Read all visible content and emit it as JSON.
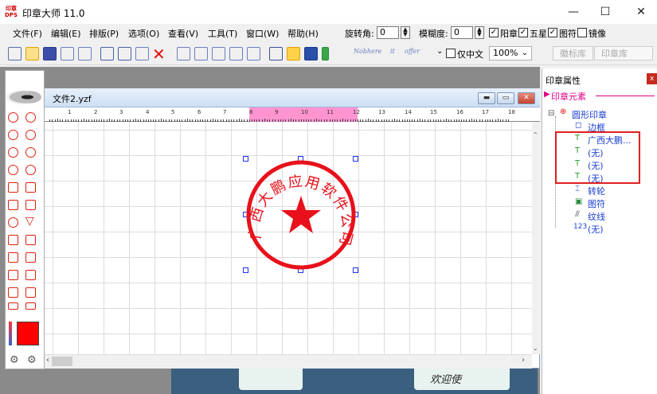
{
  "app": {
    "title": "印章大师 11.0",
    "logo_line1": "印章",
    "logo_line2": "DPS"
  },
  "window_controls": {
    "minimize": "—",
    "maximize": "☐",
    "close": "✕"
  },
  "menu": [
    "文件(F)",
    "编辑(E)",
    "排版(P)",
    "选项(O)",
    "查看(V)",
    "工具(T)",
    "窗口(W)",
    "帮助(H)"
  ],
  "controls": {
    "rotation_label": "旋转角:",
    "rotation_value": "0",
    "blur_label": "模糊度:",
    "blur_value": "0",
    "checkboxes": [
      {
        "label": "阳章",
        "checked": true
      },
      {
        "label": "五星",
        "checked": true
      },
      {
        "label": "图符",
        "checked": true
      },
      {
        "label": "镜像",
        "checked": false
      }
    ]
  },
  "toolbar": {
    "font_sample_1": "Nobhere",
    "font_sample_2": "it",
    "font_sample_3": "offer",
    "chinese_only_label": "仅中文",
    "chinese_only_checked": false,
    "zoom": "100%",
    "tabs": [
      "徽标库",
      "印章库"
    ]
  },
  "document": {
    "title": "文件2.yzf",
    "controls": {
      "minimize": "▬",
      "maximize": "▭",
      "close": "✕"
    },
    "ruler_numbers": [
      "1",
      "2",
      "3",
      "4",
      "5",
      "6",
      "7",
      "8",
      "9",
      "10",
      "11",
      "12",
      "13",
      "14",
      "15",
      "16",
      "17",
      "18"
    ]
  },
  "stamp": {
    "text": "广西大鹏应用软件公司",
    "color": "#e8101a"
  },
  "color_picker": {
    "current": "#ff0000"
  },
  "properties": {
    "title": "印章属性",
    "close": "x",
    "section": "印章元素",
    "tree": {
      "root": "圆形印章",
      "items": [
        "边框",
        "广西大鹏...",
        "(无)",
        "(无)",
        "(无)",
        "转轮",
        "图符",
        "纹线",
        "(无)"
      ]
    }
  },
  "background_text": "欢迎使"
}
